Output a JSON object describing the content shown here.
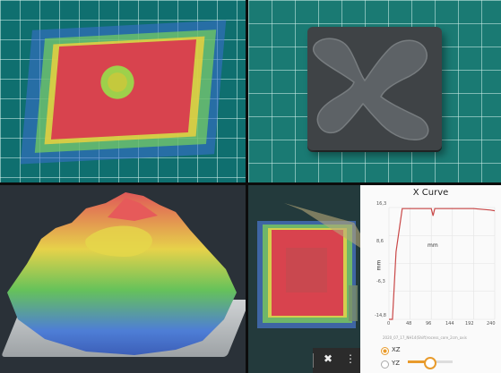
{
  "panels": {
    "top_left": {
      "description_icon": "heatmap-on-grid-mat"
    },
    "top_right": {
      "description_icon": "stone-sample-icon"
    },
    "bottom_left": {
      "description_icon": "terrain-3d-icon"
    },
    "bottom_right": {
      "chart": {
        "title": "X Curve",
        "xlabel": "mm",
        "ylabel": "mm",
        "y_ticks": [
          "16,3",
          "8,6",
          "-6,3",
          "-14,8"
        ],
        "x_ticks": [
          "0",
          "48",
          "96",
          "144",
          "192",
          "240"
        ],
        "legend_text": "2020_07_17_NH14(Shift)rocess_core_2cm_axis",
        "radios": [
          {
            "label": "XZ",
            "selected": true
          },
          {
            "label": "YZ",
            "selected": false
          }
        ],
        "slider_value_fraction": 0.45
      },
      "toolbar": {
        "close_icon": "close-icon",
        "more_icon": "more-vertical-icon"
      }
    }
  },
  "chart_data": {
    "type": "line",
    "title": "X Curve",
    "xlabel": "mm",
    "ylabel": "mm",
    "x": [
      0,
      8,
      16,
      30,
      48,
      96,
      100,
      104,
      144,
      192,
      230,
      240
    ],
    "series": [
      {
        "values": [
          -14.8,
          -14.8,
          4,
          16,
          16,
          16,
          14,
          16,
          16,
          16,
          15.6,
          15.4
        ]
      }
    ],
    "ylim": [
      -14.8,
      16.3
    ],
    "xlim": [
      0,
      240
    ],
    "grid": true
  }
}
